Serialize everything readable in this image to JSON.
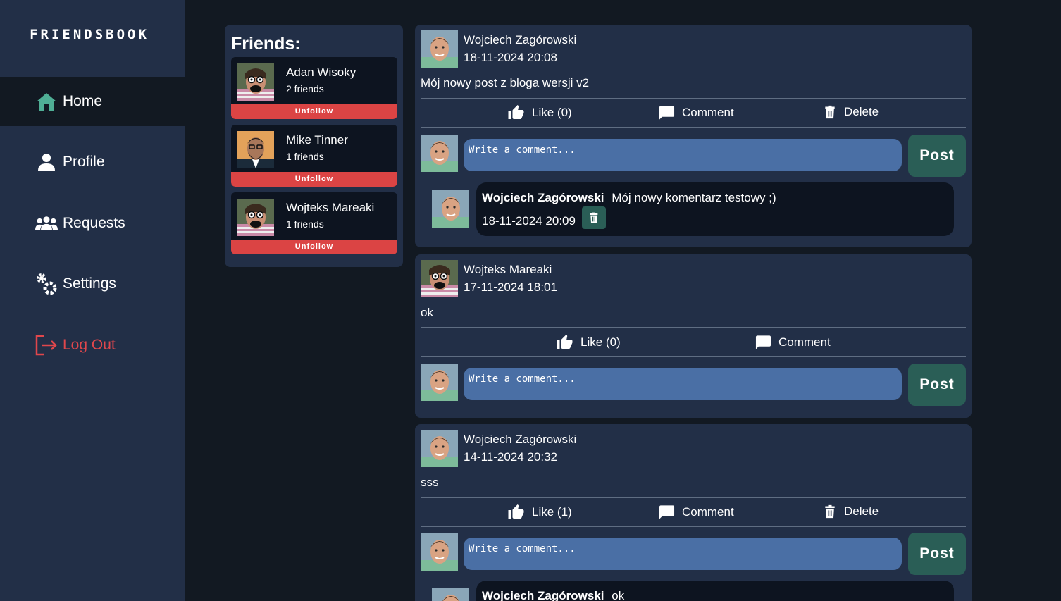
{
  "app": {
    "logo": "FRIENDSBOOK"
  },
  "sidebar": {
    "items": [
      {
        "label": "Home",
        "icon": "home-icon",
        "active": true
      },
      {
        "label": "Profile",
        "icon": "person-icon"
      },
      {
        "label": "Requests",
        "icon": "group-icon"
      },
      {
        "label": "Settings",
        "icon": "gears-icon"
      },
      {
        "label": "Log Out",
        "icon": "logout-icon",
        "color": "#e0474c"
      }
    ]
  },
  "friends": {
    "title": "Friends:",
    "unfollow_label": "Unfollow",
    "list": [
      {
        "name": "Adan Wisoky",
        "count": "2 friends"
      },
      {
        "name": "Mike Tinner",
        "count": "1 friends"
      },
      {
        "name": "Wojteks Mareaki",
        "count": "1 friends"
      }
    ]
  },
  "actions": {
    "comment": "Comment",
    "delete": "Delete",
    "post": "Post",
    "placeholder": "Write a comment..."
  },
  "posts": [
    {
      "author": "Wojciech Zagórowski",
      "date": "18-11-2024 20:08",
      "text": "Mój nowy post z bloga wersji v2",
      "like": "Like (0)",
      "comments": [
        {
          "author": "Wojciech Zagórowski",
          "text": "Mój nowy komentarz testowy ;)",
          "date": "18-11-2024 20:09"
        }
      ]
    },
    {
      "author": "Wojteks Mareaki",
      "date": "17-11-2024 18:01",
      "text": "ok",
      "like": "Like (0)"
    },
    {
      "author": "Wojciech Zagórowski",
      "date": "14-11-2024 20:32",
      "text": "sss",
      "like": "Like (1)",
      "comments": [
        {
          "author": "Wojciech Zagórowski",
          "text": "ok"
        }
      ]
    }
  ],
  "colors": {
    "background": "#121922",
    "panel": "#222f47",
    "accent": "#2a5e56",
    "danger": "#db4444",
    "input": "#4a6fa5"
  }
}
